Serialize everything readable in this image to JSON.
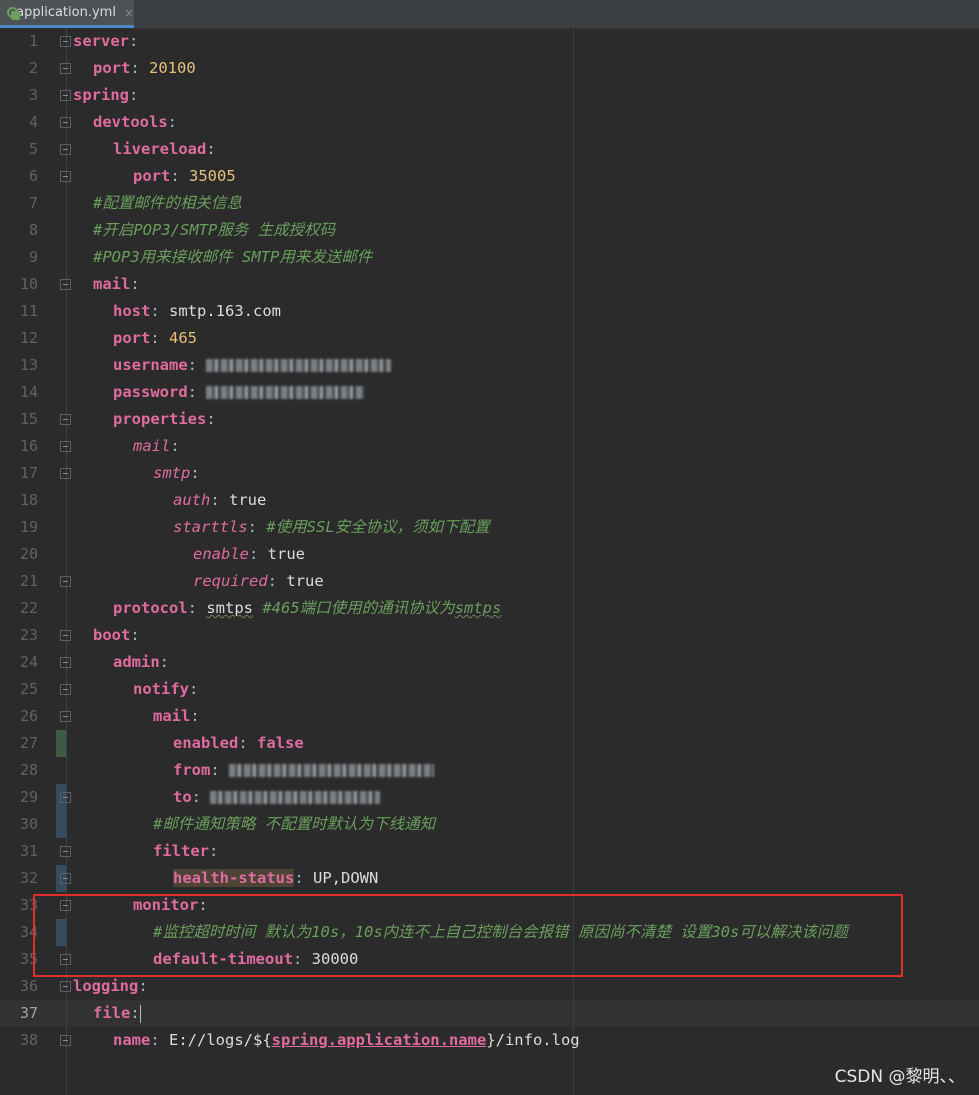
{
  "tab": {
    "filename": "application.yml",
    "icon": "yml-file-icon",
    "close": "×"
  },
  "gutter": [
    "1",
    "2",
    "3",
    "4",
    "5",
    "6",
    "7",
    "8",
    "9",
    "10",
    "11",
    "12",
    "13",
    "14",
    "15",
    "16",
    "17",
    "18",
    "19",
    "20",
    "21",
    "22",
    "23",
    "24",
    "25",
    "26",
    "27",
    "28",
    "29",
    "30",
    "31",
    "32",
    "33",
    "34",
    "35",
    "36",
    "37",
    "38"
  ],
  "code": {
    "l1_key": "server",
    "l1_sep": ":",
    "l2_key": "port",
    "l2_sep": ": ",
    "l2_val": "20100",
    "l3_key": "spring",
    "l3_sep": ":",
    "l4_key": "devtools",
    "l4_sep": ":",
    "l5_key": "livereload",
    "l5_sep": ":",
    "l6_key": "port",
    "l6_sep": ": ",
    "l6_val": "35005",
    "l7_comment": "#配置邮件的相关信息",
    "l8_comment": "#开启POP3/SMTP服务 生成授权码",
    "l9_comment": "#POP3用来接收邮件 SMTP用来发送邮件",
    "l10_key": "mail",
    "l10_sep": ":",
    "l11_key": "host",
    "l11_sep": ": ",
    "l11_val": "smtp.163.com",
    "l12_key": "port",
    "l12_sep": ": ",
    "l12_val": "465",
    "l13_key": "username",
    "l13_sep": ": ",
    "l14_key": "password",
    "l14_sep": ": ",
    "l15_key": "properties",
    "l15_sep": ":",
    "l16_key": "mail",
    "l16_sep": ":",
    "l17_key": "smtp",
    "l17_sep": ":",
    "l18_key": "auth",
    "l18_sep": ": ",
    "l18_val": "true",
    "l19_key": "starttls",
    "l19_sep": ": ",
    "l19_comment": "#使用SSL安全协议，须如下配置",
    "l20_key": "enable",
    "l20_sep": ": ",
    "l20_val": "true",
    "l21_key": "required",
    "l21_sep": ": ",
    "l21_val": "true",
    "l22_key": "protocol",
    "l22_sep": ": ",
    "l22_val": "smtps",
    "l22_comment_a": " #465端口使用的通讯协议为",
    "l22_comment_b": "smtps",
    "l23_key": "boot",
    "l23_sep": ":",
    "l24_key": "admin",
    "l24_sep": ":",
    "l25_key": "notify",
    "l25_sep": ":",
    "l26_key": "mail",
    "l26_sep": ":",
    "l27_key": "enabled",
    "l27_sep": ": ",
    "l27_val": "false",
    "l28_key": "from",
    "l28_sep": ": ",
    "l29_key": "to",
    "l29_sep": ": ",
    "l30_comment": "#邮件通知策略 不配置时默认为下线通知",
    "l31_key": "filter",
    "l31_sep": ":",
    "l32_key": "health-status",
    "l32_sep": ": ",
    "l32_val": "UP,DOWN",
    "l33_key": "monitor",
    "l33_sep": ":",
    "l34_comment": "#监控超时时间 默认为10s，10s内连不上自己控制台会报错 原因尚不清楚 设置30s可以解决该问题",
    "l35_key": "default-timeout",
    "l35_sep": ": ",
    "l35_val": "30000",
    "l36_key": "logging",
    "l36_sep": ":",
    "l37_key": "file",
    "l37_sep": ":",
    "l38_key": "name",
    "l38_sep": ": ",
    "l38_pre": "E://logs/${",
    "l38_ref": "spring.application.name",
    "l38_post": "}/info.log"
  },
  "watermark": "CSDN @黎明、、"
}
